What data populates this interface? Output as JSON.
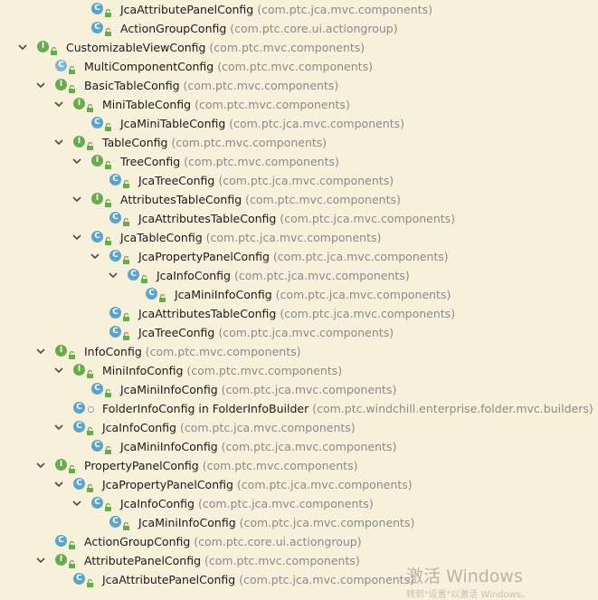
{
  "tree": [
    {
      "name": "JcaAttributePanelConfig",
      "pkg": "(com.ptc.jca.mvc.components)",
      "kind": "c",
      "depth": 3,
      "arrow": "none",
      "mod": "lock"
    },
    {
      "name": "ActionGroupConfig",
      "pkg": "(com.ptc.core.ui.actiongroup)",
      "kind": "c",
      "depth": 3,
      "arrow": "none",
      "mod": "lock"
    },
    {
      "name": "CustomizableViewConfig",
      "pkg": "(com.ptc.mvc.components)",
      "kind": "i",
      "depth": 0,
      "arrow": "down",
      "mod": "lock"
    },
    {
      "name": "MultiComponentConfig",
      "pkg": "(com.ptc.mvc.components)",
      "kind": "c",
      "depth": 1,
      "arrow": "none",
      "mod": "lock",
      "abstract": true
    },
    {
      "name": "BasicTableConfig",
      "pkg": "(com.ptc.mvc.components)",
      "kind": "i",
      "depth": 1,
      "arrow": "down",
      "mod": "lock"
    },
    {
      "name": "MiniTableConfig",
      "pkg": "(com.ptc.mvc.components)",
      "kind": "i",
      "depth": 2,
      "arrow": "down",
      "mod": "lock"
    },
    {
      "name": "JcaMiniTableConfig",
      "pkg": "(com.ptc.jca.mvc.components)",
      "kind": "c",
      "depth": 3,
      "arrow": "none",
      "mod": "lock"
    },
    {
      "name": "TableConfig",
      "pkg": "(com.ptc.mvc.components)",
      "kind": "i",
      "depth": 2,
      "arrow": "down",
      "mod": "lock"
    },
    {
      "name": "TreeConfig",
      "pkg": "(com.ptc.mvc.components)",
      "kind": "i",
      "depth": 3,
      "arrow": "down",
      "mod": "lock"
    },
    {
      "name": "JcaTreeConfig",
      "pkg": "(com.ptc.jca.mvc.components)",
      "kind": "c",
      "depth": 4,
      "arrow": "none",
      "mod": "lock"
    },
    {
      "name": "AttributesTableConfig",
      "pkg": "(com.ptc.mvc.components)",
      "kind": "i",
      "depth": 3,
      "arrow": "down",
      "mod": "lock"
    },
    {
      "name": "JcaAttributesTableConfig",
      "pkg": "(com.ptc.jca.mvc.components)",
      "kind": "c",
      "depth": 4,
      "arrow": "none",
      "mod": "lock"
    },
    {
      "name": "JcaTableConfig",
      "pkg": "(com.ptc.jca.mvc.components)",
      "kind": "c",
      "depth": 3,
      "arrow": "down",
      "mod": "lock"
    },
    {
      "name": "JcaPropertyPanelConfig",
      "pkg": "(com.ptc.jca.mvc.components)",
      "kind": "c",
      "depth": 4,
      "arrow": "down",
      "mod": "lock"
    },
    {
      "name": "JcaInfoConfig",
      "pkg": "(com.ptc.jca.mvc.components)",
      "kind": "c",
      "depth": 5,
      "arrow": "down",
      "mod": "lock"
    },
    {
      "name": "JcaMiniInfoConfig",
      "pkg": "(com.ptc.jca.mvc.components)",
      "kind": "c",
      "depth": 6,
      "arrow": "none",
      "mod": "lock"
    },
    {
      "name": "JcaAttributesTableConfig",
      "pkg": "(com.ptc.jca.mvc.components)",
      "kind": "c",
      "depth": 4,
      "arrow": "none",
      "mod": "lock"
    },
    {
      "name": "JcaTreeConfig",
      "pkg": "(com.ptc.jca.mvc.components)",
      "kind": "c",
      "depth": 4,
      "arrow": "none",
      "mod": "lock"
    },
    {
      "name": "InfoConfig",
      "pkg": "(com.ptc.mvc.components)",
      "kind": "i",
      "depth": 1,
      "arrow": "down",
      "mod": "lock"
    },
    {
      "name": "MiniInfoConfig",
      "pkg": "(com.ptc.mvc.components)",
      "kind": "i",
      "depth": 2,
      "arrow": "down",
      "mod": "lock"
    },
    {
      "name": "JcaMiniInfoConfig",
      "pkg": "(com.ptc.jca.mvc.components)",
      "kind": "c",
      "depth": 3,
      "arrow": "none",
      "mod": "lock"
    },
    {
      "name": "FolderInfoConfig in FolderInfoBuilder",
      "pkg": "(com.ptc.windchill.enterprise.folder.mvc.builders)",
      "kind": "c",
      "depth": 2,
      "arrow": "none",
      "mod": "dot"
    },
    {
      "name": "JcaInfoConfig",
      "pkg": "(com.ptc.jca.mvc.components)",
      "kind": "c",
      "depth": 2,
      "arrow": "down",
      "mod": "lock"
    },
    {
      "name": "JcaMiniInfoConfig",
      "pkg": "(com.ptc.jca.mvc.components)",
      "kind": "c",
      "depth": 3,
      "arrow": "none",
      "mod": "lock"
    },
    {
      "name": "PropertyPanelConfig",
      "pkg": "(com.ptc.mvc.components)",
      "kind": "i",
      "depth": 1,
      "arrow": "down",
      "mod": "lock"
    },
    {
      "name": "JcaPropertyPanelConfig",
      "pkg": "(com.ptc.jca.mvc.components)",
      "kind": "c",
      "depth": 2,
      "arrow": "down",
      "mod": "lock"
    },
    {
      "name": "JcaInfoConfig",
      "pkg": "(com.ptc.jca.mvc.components)",
      "kind": "c",
      "depth": 3,
      "arrow": "down",
      "mod": "lock"
    },
    {
      "name": "JcaMiniInfoConfig",
      "pkg": "(com.ptc.jca.mvc.components)",
      "kind": "c",
      "depth": 4,
      "arrow": "none",
      "mod": "lock"
    },
    {
      "name": "ActionGroupConfig",
      "pkg": "(com.ptc.core.ui.actiongroup)",
      "kind": "c",
      "depth": 1,
      "arrow": "none",
      "mod": "lock"
    },
    {
      "name": "AttributePanelConfig",
      "pkg": "(com.ptc.mvc.components)",
      "kind": "i",
      "depth": 1,
      "arrow": "down",
      "mod": "lock"
    },
    {
      "name": "JcaAttributePanelConfig",
      "pkg": "(com.ptc.jca.mvc.components)",
      "kind": "c",
      "depth": 2,
      "arrow": "none",
      "mod": "lock"
    }
  ],
  "watermark": {
    "title": "激活 Windows",
    "subtitle": "转到\"设置\"以激活 Windows。"
  }
}
